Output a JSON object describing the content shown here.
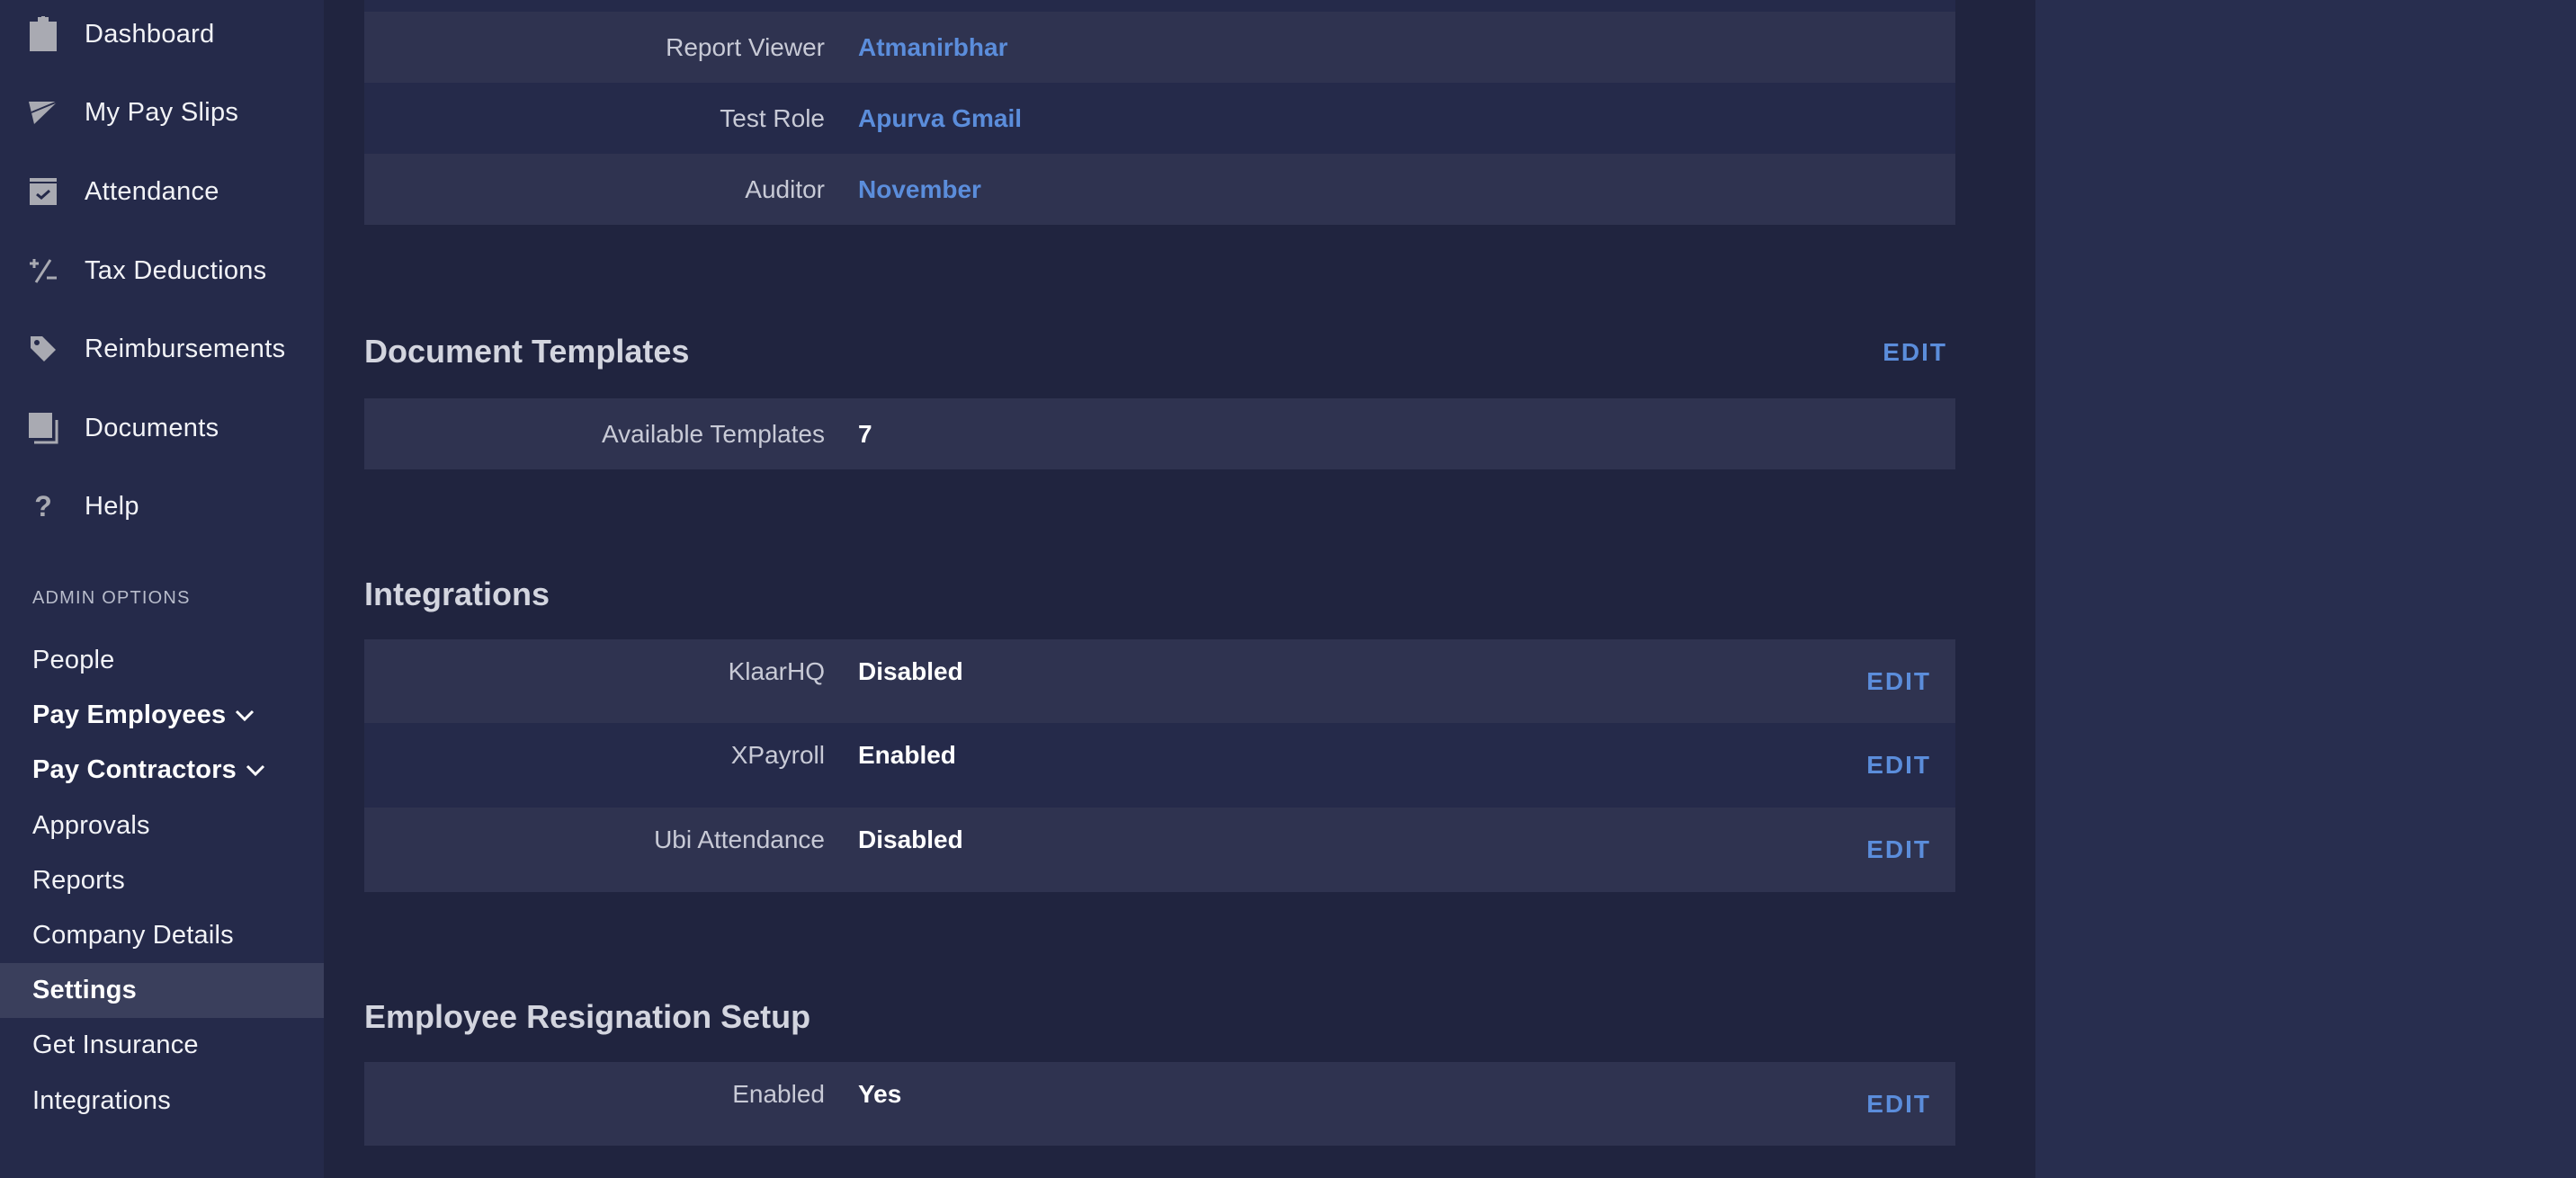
{
  "sidebar": {
    "main_items": [
      {
        "label": "Dashboard",
        "icon": "clipboard-icon"
      },
      {
        "label": "My Pay Slips",
        "icon": "paper-plane-icon"
      },
      {
        "label": "Attendance",
        "icon": "calendar-check-icon"
      },
      {
        "label": "Tax Deductions",
        "icon": "plus-minus-icon"
      },
      {
        "label": "Reimbursements",
        "icon": "tag-icon"
      },
      {
        "label": "Documents",
        "icon": "documents-icon"
      },
      {
        "label": "Help",
        "icon": "question-icon"
      }
    ],
    "admin_title": "ADMIN OPTIONS",
    "admin_items": [
      {
        "label": "People"
      },
      {
        "label": "Pay Employees",
        "expandable": true
      },
      {
        "label": "Pay Contractors",
        "expandable": true
      },
      {
        "label": "Approvals"
      },
      {
        "label": "Reports"
      },
      {
        "label": "Company Details"
      },
      {
        "label": "Settings",
        "active": true
      },
      {
        "label": "Get Insurance"
      },
      {
        "label": "Integrations"
      }
    ]
  },
  "roles": {
    "rows": [
      {
        "label": "Report Viewer",
        "value": "Atmanirbhar"
      },
      {
        "label": "Test Role",
        "value": "Apurva Gmail"
      },
      {
        "label": "Auditor",
        "value": "November"
      }
    ]
  },
  "document_templates": {
    "title": "Document Templates",
    "edit_label": "EDIT",
    "rows": [
      {
        "label": "Available Templates",
        "value": "7"
      }
    ]
  },
  "integrations": {
    "title": "Integrations",
    "rows": [
      {
        "label": "KlaarHQ",
        "value": "Disabled",
        "edit_label": "EDIT"
      },
      {
        "label": "XPayroll",
        "value": "Enabled",
        "edit_label": "EDIT"
      },
      {
        "label": "Ubi Attendance",
        "value": "Disabled",
        "edit_label": "EDIT"
      }
    ]
  },
  "resignation": {
    "title": "Employee Resignation Setup",
    "rows": [
      {
        "label": "Enabled",
        "value": "Yes",
        "edit_label": "EDIT"
      }
    ]
  },
  "colors": {
    "accent": "#5b8ddb",
    "sidebar_bg": "#252a4a",
    "main_bg": "#20243f",
    "card_bg": "#2f3350",
    "active_item_bg": "#3a3f5c"
  }
}
